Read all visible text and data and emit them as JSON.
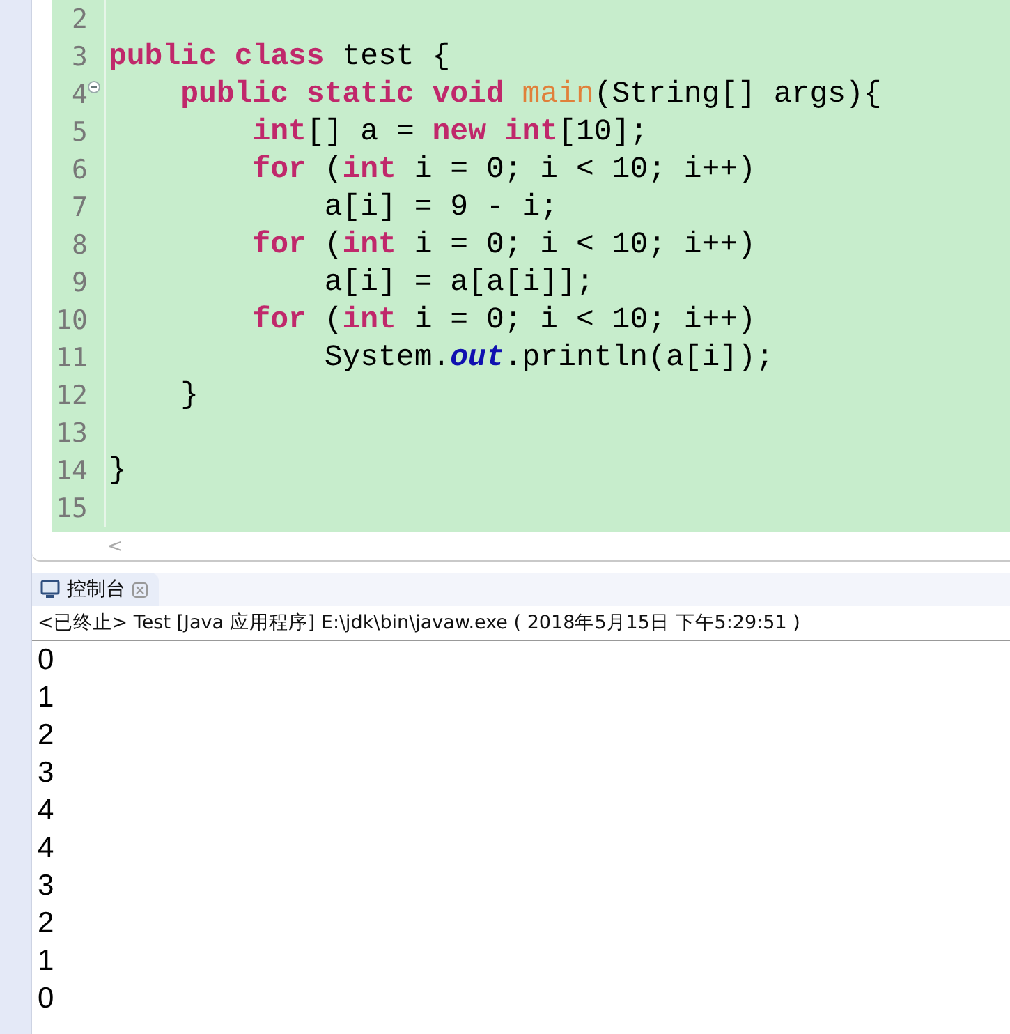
{
  "editor": {
    "lines": [
      {
        "number": "2"
      },
      {
        "number": "3",
        "tokens": [
          {
            "text": "public class",
            "kind": "keyword"
          },
          {
            "text": " test {",
            "kind": "plain"
          }
        ]
      },
      {
        "number": "4",
        "fold": true,
        "tokens": [
          {
            "text": "    public static void",
            "kind": "keyword"
          },
          {
            "text": " main",
            "kind": "method"
          },
          {
            "text": "(String[] args){",
            "kind": "plain"
          }
        ]
      },
      {
        "number": "5",
        "tokens": [
          {
            "text": "        int",
            "kind": "keyword"
          },
          {
            "text": "[] a = ",
            "kind": "plain"
          },
          {
            "text": "new int",
            "kind": "keyword"
          },
          {
            "text": "[10];",
            "kind": "plain"
          }
        ]
      },
      {
        "number": "6",
        "tokens": [
          {
            "text": "        for",
            "kind": "keyword"
          },
          {
            "text": " (",
            "kind": "plain"
          },
          {
            "text": "int",
            "kind": "keyword"
          },
          {
            "text": " i = 0; i < 10; i++)",
            "kind": "plain"
          }
        ]
      },
      {
        "number": "7",
        "tokens": [
          {
            "text": "            a[i] = 9 - i;",
            "kind": "plain"
          }
        ]
      },
      {
        "number": "8",
        "tokens": [
          {
            "text": "        for",
            "kind": "keyword"
          },
          {
            "text": " (",
            "kind": "plain"
          },
          {
            "text": "int",
            "kind": "keyword"
          },
          {
            "text": " i = 0; i < 10; i++)",
            "kind": "plain"
          }
        ]
      },
      {
        "number": "9",
        "tokens": [
          {
            "text": "            a[i] = a[a[i]];",
            "kind": "plain"
          }
        ]
      },
      {
        "number": "10",
        "tokens": [
          {
            "text": "        for",
            "kind": "keyword"
          },
          {
            "text": " (",
            "kind": "plain"
          },
          {
            "text": "int",
            "kind": "keyword"
          },
          {
            "text": " i = 0; i < 10; i++)",
            "kind": "plain"
          }
        ]
      },
      {
        "number": "11",
        "tokens": [
          {
            "text": "            System.",
            "kind": "plain"
          },
          {
            "text": "out",
            "kind": "field"
          },
          {
            "text": ".println(a[i]);",
            "kind": "plain"
          }
        ]
      },
      {
        "number": "12",
        "tokens": [
          {
            "text": "    }",
            "kind": "plain"
          }
        ]
      },
      {
        "number": "13"
      },
      {
        "number": "14",
        "tokens": [
          {
            "text": "}",
            "kind": "plain"
          }
        ]
      },
      {
        "number": "15"
      }
    ],
    "scroll_left": "<"
  },
  "console": {
    "tab": {
      "label": "控制台"
    },
    "status": "<已终止> Test [Java 应用程序] E:\\jdk\\bin\\javaw.exe ( 2018年5月15日 下午5:29:51 )",
    "output": [
      "0",
      "1",
      "2",
      "3",
      "4",
      "4",
      "3",
      "2",
      "1",
      "0"
    ]
  }
}
